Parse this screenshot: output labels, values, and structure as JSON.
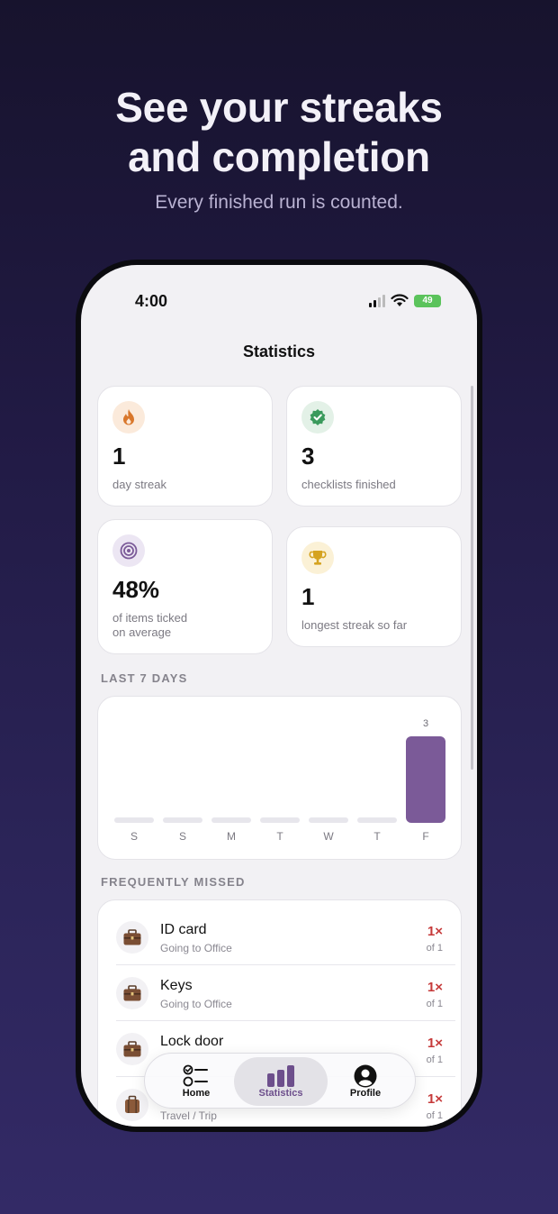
{
  "promo": {
    "headline_line1": "See your streaks",
    "headline_line2": "and completion",
    "subheadline": "Every finished run is counted."
  },
  "status_bar": {
    "time": "4:00",
    "battery": "49"
  },
  "screen": {
    "title": "Statistics"
  },
  "stats": [
    {
      "value": "1",
      "label": "day streak",
      "icon": "flame-icon",
      "icon_bg": "#fbeadb",
      "icon_color": "#d9772b"
    },
    {
      "value": "3",
      "label": "checklists finished",
      "icon": "check-badge-icon",
      "icon_bg": "#e3f1e7",
      "icon_color": "#3a9a5c"
    },
    {
      "value": "48%",
      "label_line1": "of items ticked",
      "label_line2": "on average",
      "icon": "target-icon",
      "icon_bg": "#ece6f3",
      "icon_color": "#7b5a98"
    },
    {
      "value": "1",
      "label": "longest streak so far",
      "icon": "trophy-icon",
      "icon_bg": "#fbf1d6",
      "icon_color": "#d5a320"
    }
  ],
  "last7": {
    "section_label": "LAST 7 DAYS",
    "fill_color": "#7b5a98"
  },
  "chart_data": {
    "type": "bar",
    "title": "LAST 7 DAYS",
    "categories": [
      "S",
      "S",
      "M",
      "T",
      "W",
      "T",
      "F"
    ],
    "values": [
      0,
      0,
      0,
      0,
      0,
      0,
      3
    ],
    "data_labels": [
      "",
      "",
      "",
      "",
      "",
      "",
      "3"
    ],
    "ylim": [
      0,
      3
    ],
    "grid": false
  },
  "missed": {
    "section_label": "FREQUENTLY MISSED",
    "items": [
      {
        "name": "ID card",
        "list": "Going to Office",
        "count": "1×",
        "of": "of 1",
        "icon": "briefcase-icon"
      },
      {
        "name": "Keys",
        "list": "Going to Office",
        "count": "1×",
        "of": "of 1",
        "icon": "briefcase-icon"
      },
      {
        "name": "Lock door",
        "list": "",
        "count": "1×",
        "of": "of 1",
        "icon": "briefcase-icon"
      },
      {
        "name": "",
        "list": "Travel / Trip",
        "count": "1×",
        "of": "of 1",
        "icon": "suitcase-icon"
      }
    ]
  },
  "tabbar": {
    "tabs": [
      {
        "label": "Home",
        "icon": "checklist-icon"
      },
      {
        "label": "Statistics",
        "icon": "bar-chart-icon",
        "active": true
      },
      {
        "label": "Profile",
        "icon": "person-icon"
      }
    ]
  }
}
